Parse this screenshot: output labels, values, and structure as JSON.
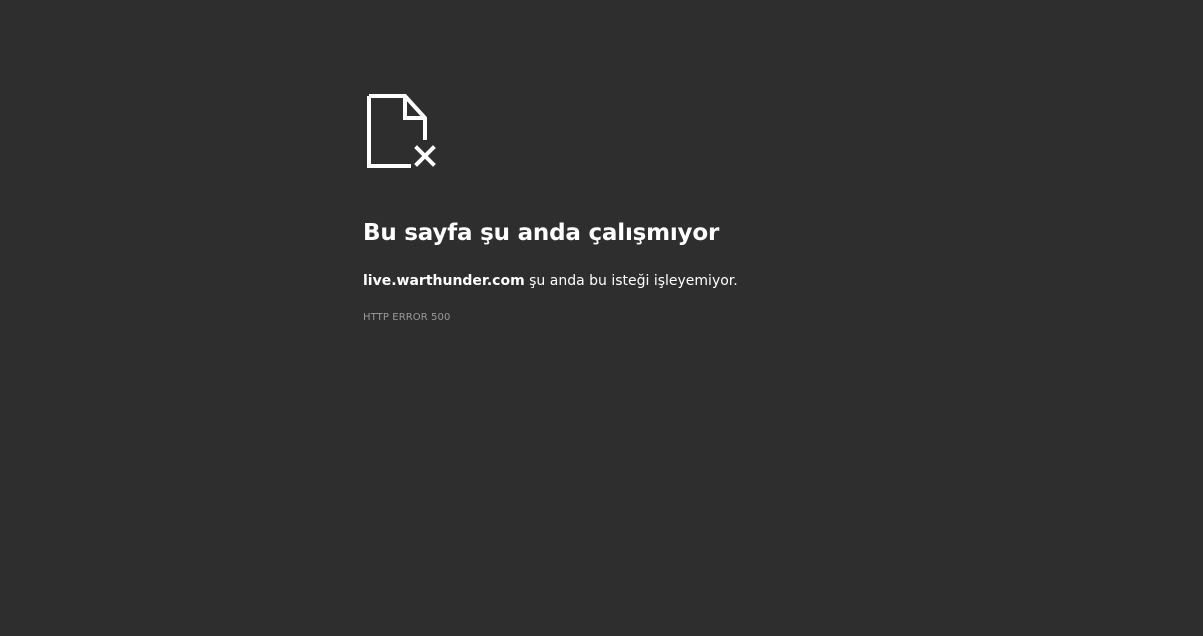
{
  "error": {
    "icon": "file-error-icon",
    "title": "Bu sayfa şu anda çalışmıyor",
    "domain": "live.warthunder.com",
    "message": " şu anda bu isteği işleyemiyor.",
    "code": "HTTP ERROR 500"
  },
  "colors": {
    "background": "#2e2e2e",
    "text": "#ffffff",
    "muted": "#9a9a9a"
  }
}
